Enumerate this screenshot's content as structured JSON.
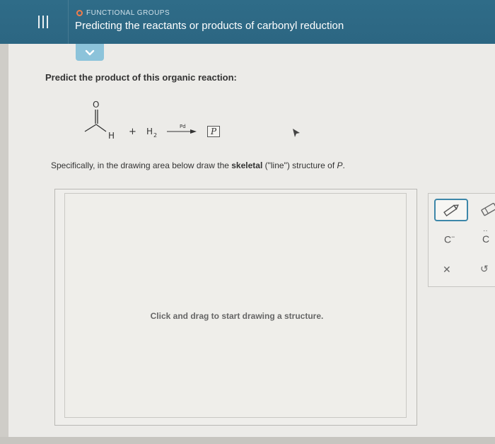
{
  "header": {
    "topic_label": "FUNCTIONAL GROUPS",
    "title": "Predicting the reactants or products of carbonyl reduction",
    "background_color": "#2e6985",
    "topic_dot_color": "#f17c4b"
  },
  "question": {
    "prompt": "Predict the product of this organic reaction:",
    "reaction": {
      "reactant_atom_O": "O",
      "reactant_atom_H": "H",
      "plus": "+",
      "reagent": "H",
      "reagent_subscript": "2",
      "catalyst": "Pd",
      "product_symbol": "P"
    },
    "instruction_pre": "Specifically, in the drawing area below draw the ",
    "instruction_bold": "skeletal",
    "instruction_mid": " (\"line\") structure of ",
    "instruction_italic": "P",
    "instruction_post": "."
  },
  "drawing_area": {
    "hint": "Click and drag to start drawing a structure."
  },
  "toolbar": {
    "items": [
      {
        "name": "pencil-icon",
        "active": true
      },
      {
        "name": "eraser-icon"
      },
      {
        "label": "C",
        "sup": "−"
      },
      {
        "label": "C",
        "sup": "··"
      },
      {
        "name": "close-icon",
        "glyph": "✕"
      },
      {
        "name": "undo-icon",
        "glyph": "↺"
      }
    ],
    "accent_color": "#3d87a9"
  }
}
